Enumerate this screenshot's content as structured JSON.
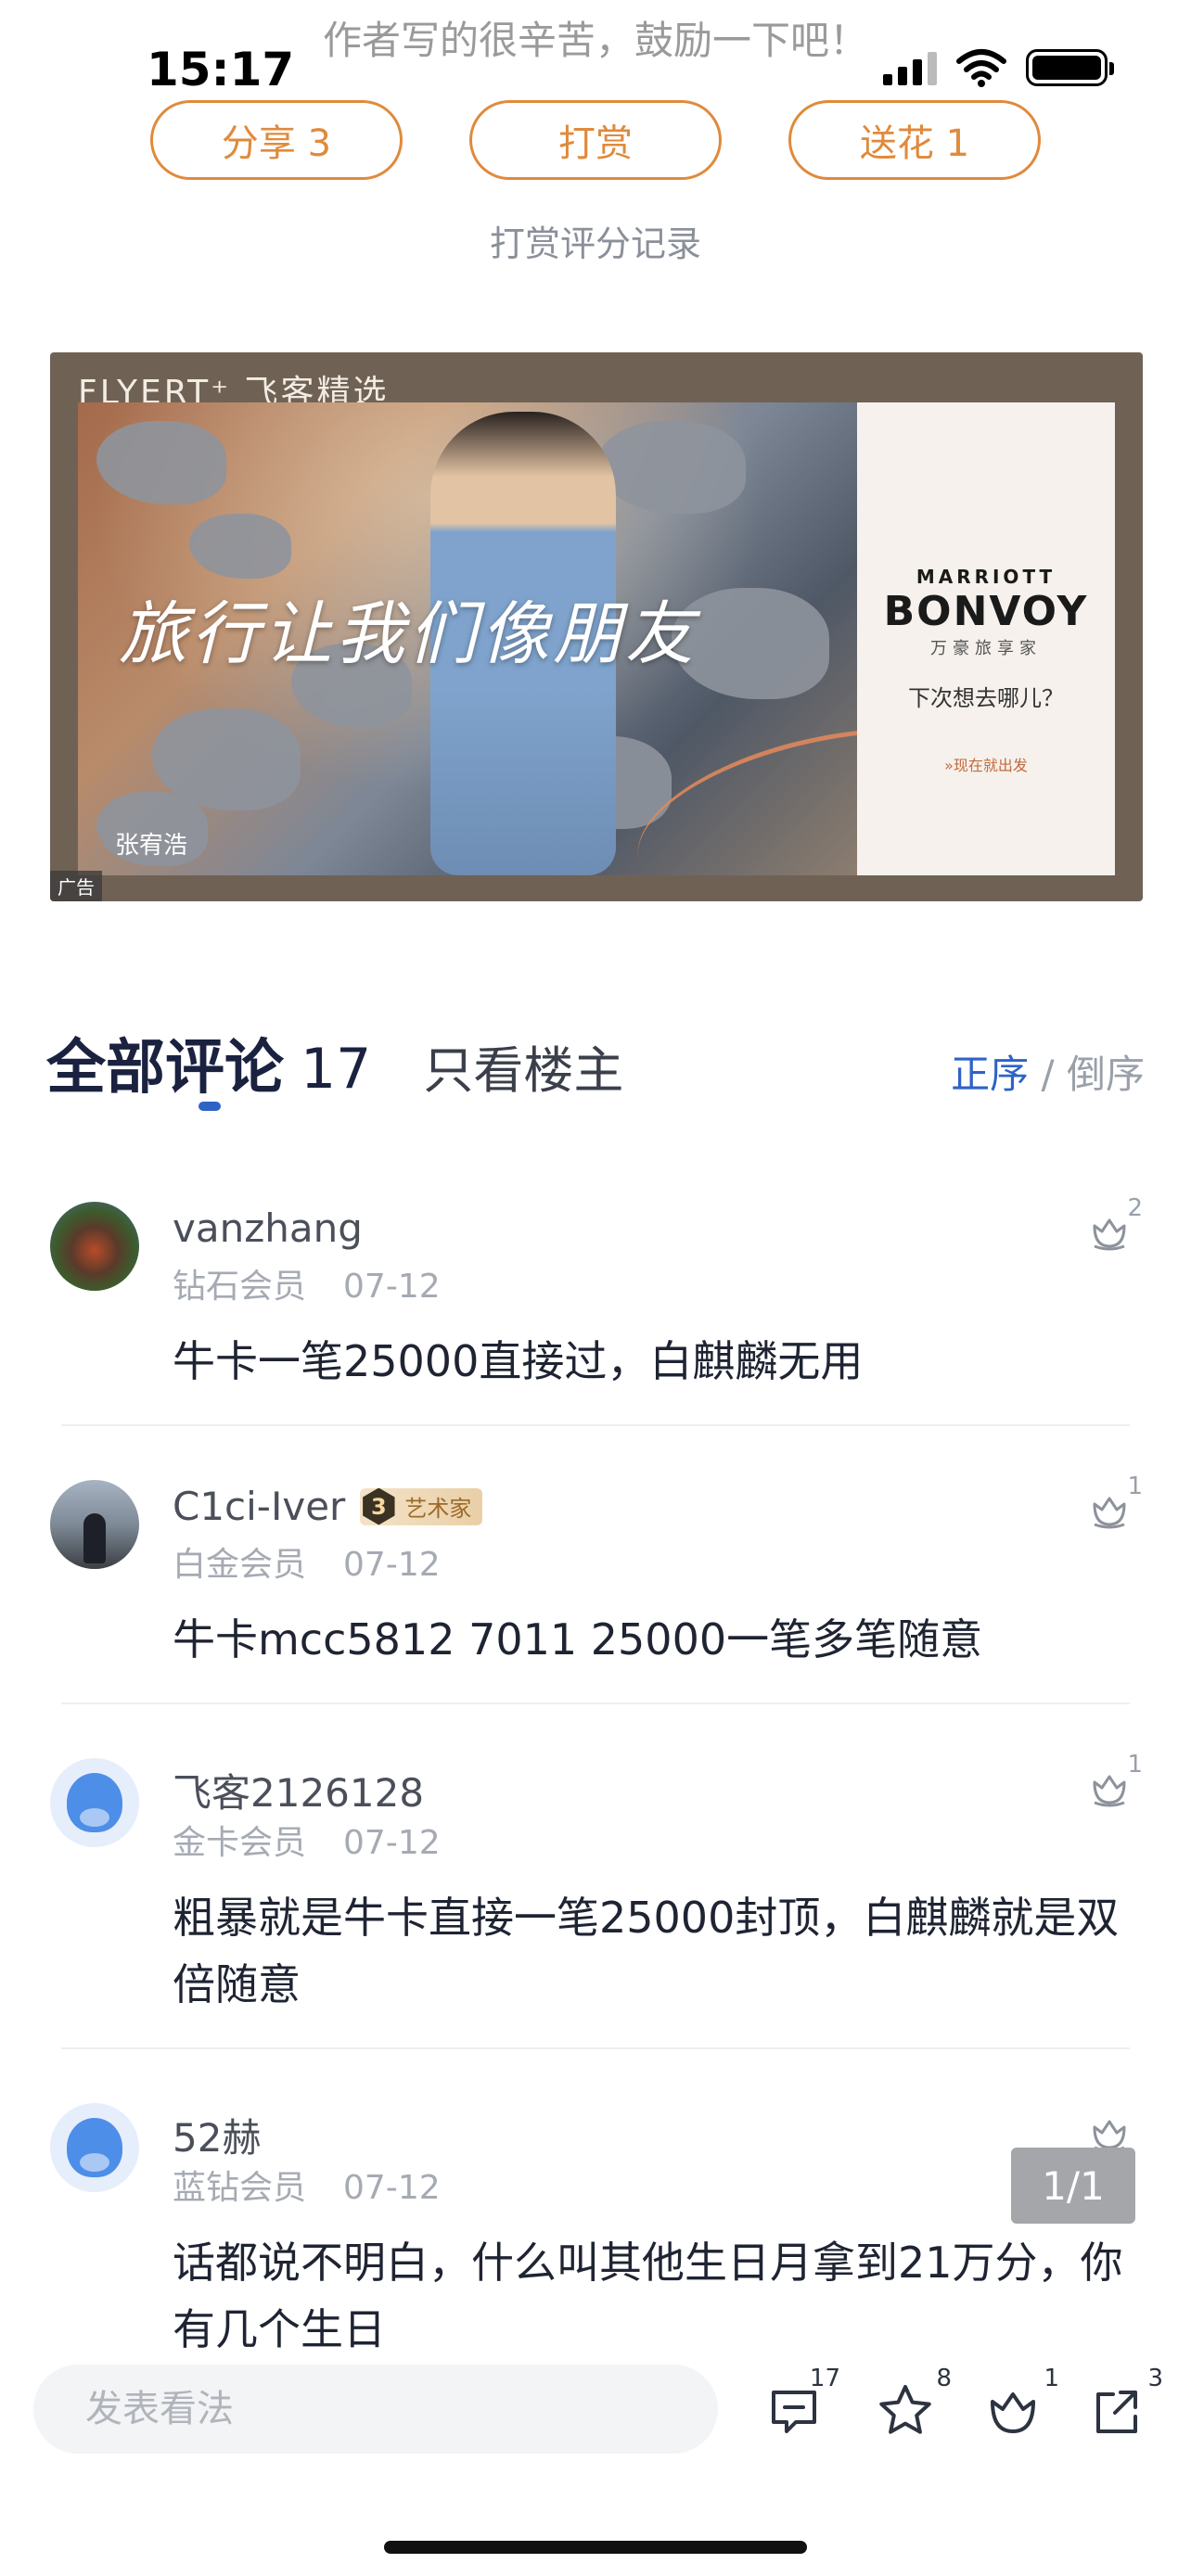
{
  "status_bar": {
    "time": "15:17"
  },
  "encourage_text": "作者写的很辛苦，鼓励一下吧！",
  "actions": {
    "share": "分享 3",
    "reward": "打赏",
    "flower": "送花 1"
  },
  "reward_record": "打赏评分记录",
  "ad": {
    "brand": "FLYERT⁺ 飞客精选",
    "slogan": "旅行让我们像朋友",
    "caption": "张宥浩",
    "panel_marriott": "MARRIOTT",
    "panel_bonvoy": "BONVOY",
    "panel_cn": "万豪旅享家",
    "panel_question": "下次想去哪儿？",
    "panel_cta": "»现在就出发",
    "tag": "广告"
  },
  "comments_header": {
    "title": "全部评论",
    "count": "17",
    "owner_only": "只看楼主",
    "sort_asc": "正序",
    "sort_sep": " / ",
    "sort_desc": "倒序"
  },
  "comments": [
    {
      "name": "vanzhang",
      "level": "钻石会员",
      "date": "07-12",
      "text": "牛卡一笔25000直接过，白麒麟无用",
      "likes": "2"
    },
    {
      "name": "C1ci-Iver",
      "badge_level": "3",
      "badge_title": "艺术家",
      "level": "白金会员",
      "date": "07-12",
      "text": "牛卡mcc5812 7011 25000一笔多笔随意",
      "likes": "1"
    },
    {
      "name": "飞客2126128",
      "level": "金卡会员",
      "date": "07-12",
      "text": "粗暴就是牛卡直接一笔25000封顶，白麒麟就是双倍随意",
      "likes": "1"
    },
    {
      "name": "52赫",
      "level": "蓝钻会员",
      "date": "07-12",
      "text": "话都说不明白，什么叫其他生日月拿到21万分，你有几个生日",
      "likes": ""
    }
  ],
  "page_indicator": "1/1",
  "bottom_bar": {
    "placeholder": "发表看法",
    "comment_count": "17",
    "favorite_count": "8",
    "flower_count": "1",
    "share_count": "3"
  },
  "colors": {
    "accent_orange": "#e08a3c",
    "accent_blue": "#2e63c6"
  }
}
